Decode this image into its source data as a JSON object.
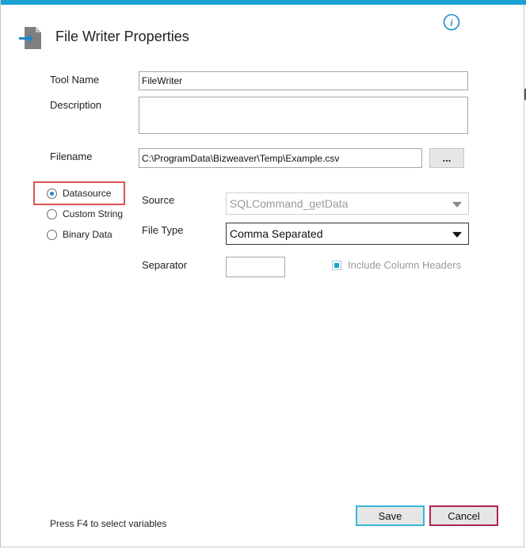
{
  "window": {
    "title": "File Writer Properties",
    "accent_color": "#1ba1d2"
  },
  "icons": {
    "app": "file-writer-icon",
    "info": "info-icon",
    "info_glyph": "i"
  },
  "form": {
    "tool_name": {
      "label": "Tool Name",
      "value": "FileWriter"
    },
    "description": {
      "label": "Description",
      "value": ""
    },
    "filename": {
      "label": "Filename",
      "value": "C:\\ProgramData\\Bizweaver\\Temp\\Example.csv",
      "browse_label": "..."
    }
  },
  "source_type": {
    "options": [
      "Datasource",
      "Custom String",
      "Binary Data"
    ],
    "selected": "Datasource",
    "highlight_color": "#d9534f"
  },
  "datasource": {
    "source": {
      "label": "Source",
      "value": "SQLCommand_getData",
      "enabled": false
    },
    "file_type": {
      "label": "File Type",
      "value": "Comma Separated"
    },
    "separator": {
      "label": "Separator",
      "value": ""
    },
    "include_headers": {
      "label": "Include Column Headers",
      "checked": true,
      "enabled": false
    }
  },
  "footer": {
    "hint": "Press F4 to select variables",
    "save_label": "Save",
    "cancel_label": "Cancel",
    "save_border": "#38b6d8",
    "cancel_border": "#b0254f"
  }
}
